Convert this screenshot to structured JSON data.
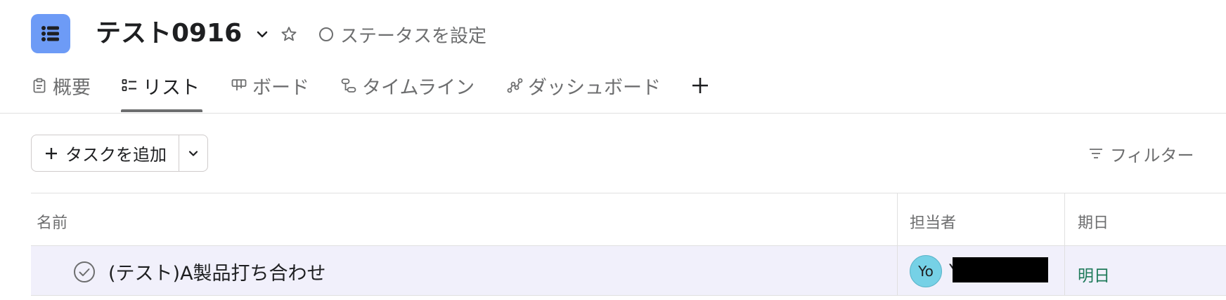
{
  "project": {
    "title": "テスト0916",
    "status_label": "ステータスを設定"
  },
  "tabs": [
    {
      "label": "概要",
      "icon": "clipboard-icon"
    },
    {
      "label": "リスト",
      "icon": "list-icon",
      "active": true
    },
    {
      "label": "ボード",
      "icon": "board-icon"
    },
    {
      "label": "タイムライン",
      "icon": "timeline-icon"
    },
    {
      "label": "ダッシュボード",
      "icon": "dashboard-icon"
    }
  ],
  "toolbar": {
    "add_task_label": "タスクを追加",
    "filter_label": "フィルター"
  },
  "table": {
    "columns": [
      "名前",
      "担当者",
      "期日"
    ],
    "rows": [
      {
        "name": "(テスト)A製品打ち合わせ",
        "assignee_initials": "Yo",
        "assignee_name_visible": "Y",
        "due": "明日"
      }
    ]
  },
  "colors": {
    "project_icon": "#6d9bf6",
    "row_highlight": "#f1f0fb",
    "avatar": "#76d1e6",
    "due_text": "#1f7a5a"
  }
}
